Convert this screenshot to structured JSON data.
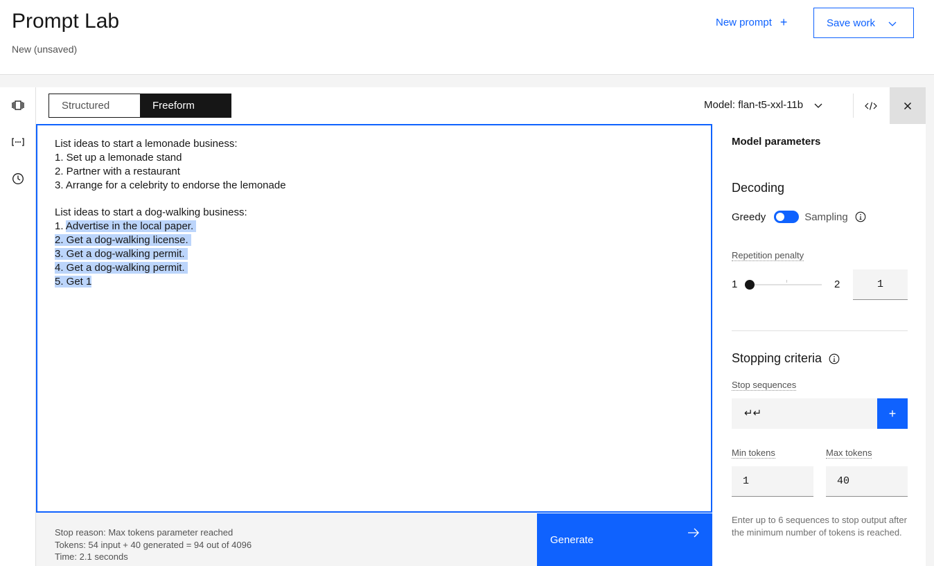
{
  "header": {
    "title": "Prompt Lab",
    "subtitle": "New (unsaved)",
    "new_prompt": "New prompt",
    "save_work": "Save work"
  },
  "toolbar": {
    "modes": [
      "Structured",
      "Freeform"
    ],
    "active_mode": "Freeform",
    "model_label": "Model: flan-t5-xxl-11b"
  },
  "editor": {
    "lines": [
      {
        "prefix": "List ideas to start a lemonade business:",
        "highlight": ""
      },
      {
        "prefix": "1. Set up a lemonade stand",
        "highlight": ""
      },
      {
        "prefix": "2. Partner with a restaurant",
        "highlight": ""
      },
      {
        "prefix": "3. Arrange for a celebrity to endorse the lemonade",
        "highlight": ""
      },
      {
        "prefix": "",
        "highlight": ""
      },
      {
        "prefix": "List ideas to start a dog-walking business:",
        "highlight": ""
      },
      {
        "prefix": "1. ",
        "highlight": "Advertise in the local paper. "
      },
      {
        "prefix": "",
        "highlight": "2. Get a dog-walking license. "
      },
      {
        "prefix": "",
        "highlight": "3. Get a dog-walking permit. "
      },
      {
        "prefix": "",
        "highlight": "4. Get a dog-walking permit. "
      },
      {
        "prefix": "",
        "highlight": "5. Get 1"
      }
    ]
  },
  "status": {
    "stop_reason": "Stop reason: Max tokens parameter reached",
    "tokens": "Tokens: 54 input + 40 generated = 94 out of 4096",
    "time": "Time: 2.1 seconds"
  },
  "generate_label": "Generate",
  "panel": {
    "title": "Model parameters",
    "decoding": "Decoding",
    "greedy": "Greedy",
    "sampling": "Sampling",
    "repetition_label": "Repetition penalty",
    "rep_min": "1",
    "rep_max": "2",
    "rep_value": "1",
    "stopping": "Stopping criteria",
    "stop_sequences_label": "Stop sequences",
    "stop_sequence_value": "↵↵",
    "min_tokens_label": "Min tokens",
    "max_tokens_label": "Max tokens",
    "min_tokens": "1",
    "max_tokens": "40",
    "helper": "Enter up to 6 sequences to stop output after the minimum number of tokens is reached."
  },
  "colors": {
    "accent": "#0f62fe",
    "highlight": "#bcd5fb",
    "dark": "#161616"
  }
}
